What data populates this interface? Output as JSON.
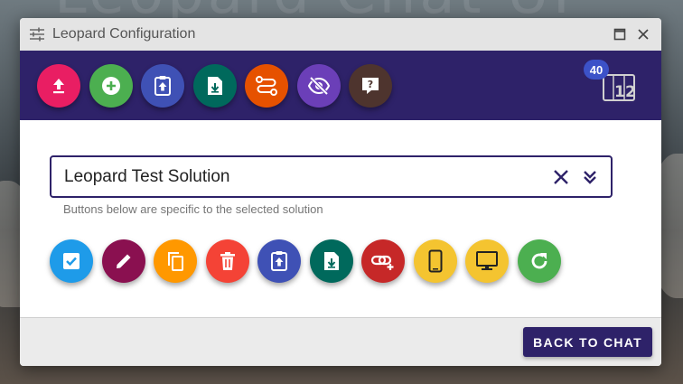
{
  "window": {
    "title": "Leopard Configuration",
    "title_icon": "tune-sliders-icon"
  },
  "background": {
    "faint_text": "Leopard Chat UI"
  },
  "toolbar": {
    "buttons": [
      {
        "name": "upload-button",
        "icon": "upload-icon",
        "color": "#e91e63"
      },
      {
        "name": "add-button",
        "icon": "plus-circle-icon",
        "color": "#4caf50"
      },
      {
        "name": "clipboard-upload-button",
        "icon": "clipboard-upload-icon",
        "color": "#3f51b5"
      },
      {
        "name": "file-download-button",
        "icon": "file-download-icon",
        "color": "#00695c"
      },
      {
        "name": "routes-button",
        "icon": "routes-icon",
        "color": "#e65100"
      },
      {
        "name": "hide-button",
        "icon": "eye-off-icon",
        "color": "#6b3fb8"
      },
      {
        "name": "help-button",
        "icon": "help-bubble-icon",
        "color": "#4e342e"
      }
    ],
    "counter": {
      "badge": "40",
      "icon": "counter-icon",
      "badge_color": "#3c52c8"
    }
  },
  "solution_select": {
    "value": "Leopard Test Solution",
    "clear_icon": "close-icon",
    "expand_icon": "double-chevron-down-icon",
    "hint": "Buttons below are specific to the selected solution"
  },
  "actions": [
    {
      "name": "confirm-button",
      "icon": "checkbox-icon",
      "color": "#1e9be9"
    },
    {
      "name": "edit-button",
      "icon": "pencil-icon",
      "color": "#8a1050"
    },
    {
      "name": "copy-button",
      "icon": "copy-icon",
      "color": "#ff9800"
    },
    {
      "name": "delete-button",
      "icon": "trash-icon",
      "color": "#f44336"
    },
    {
      "name": "clipboard-upload-button",
      "icon": "clipboard-upload-icon",
      "color": "#3f51b5"
    },
    {
      "name": "file-download-button",
      "icon": "file-download-icon",
      "color": "#00695c"
    },
    {
      "name": "link-add-button",
      "icon": "link-plus-icon",
      "color": "#c62828"
    },
    {
      "name": "mobile-button",
      "icon": "cellphone-icon",
      "color": "#f4c430"
    },
    {
      "name": "desktop-button",
      "icon": "monitor-icon",
      "color": "#f4c430"
    },
    {
      "name": "refresh-button",
      "icon": "refresh-icon",
      "color": "#4caf50"
    }
  ],
  "footer": {
    "back_label": "BACK TO CHAT",
    "back_color": "#2e2269"
  }
}
